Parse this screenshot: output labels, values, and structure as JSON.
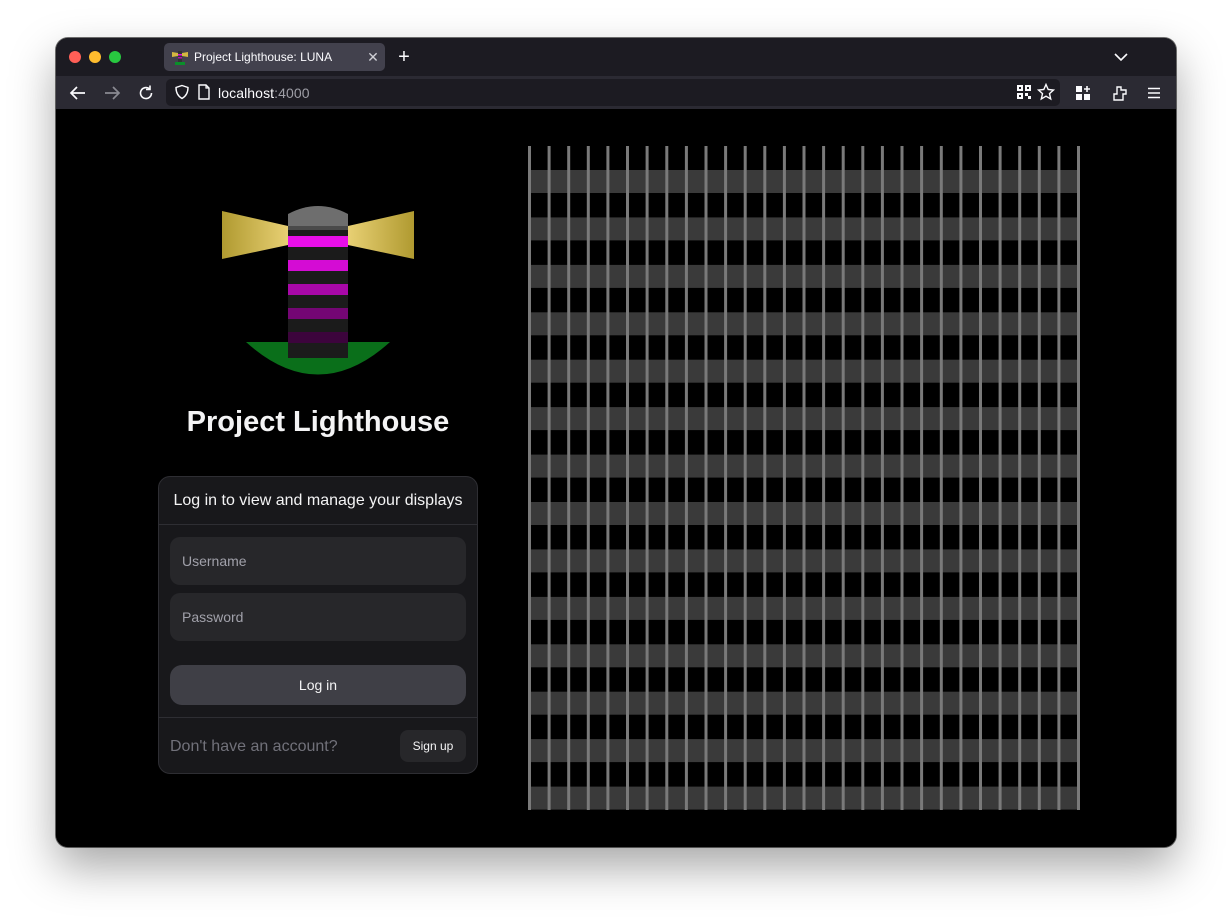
{
  "browser": {
    "tab_title": "Project Lighthouse: LUNA",
    "url_host": "localhost",
    "url_port": ":4000"
  },
  "page": {
    "title": "Project Lighthouse",
    "login_card": {
      "header": "Log in to view and manage your displays",
      "username_placeholder": "Username",
      "password_placeholder": "Password",
      "login_button": "Log in",
      "no_account_text": "Don't have an account?",
      "signup_button": "Sign up"
    }
  },
  "colors": {
    "background": "#000000",
    "card": "#18181b",
    "lighthouse_stripe": "#e010e0",
    "beam": "#d4b840",
    "ground": "#0a6f1a",
    "window_column": "#7a7a7a",
    "floor_band": "#3a3a3a"
  },
  "icons": [
    "back-arrow-icon",
    "forward-arrow-icon",
    "reload-icon",
    "shield-icon",
    "page-icon",
    "qr-code-icon",
    "bookmark-star-icon",
    "extensions-icon",
    "share-icon",
    "menu-icon",
    "chevron-down-icon",
    "close-icon",
    "plus-icon"
  ]
}
